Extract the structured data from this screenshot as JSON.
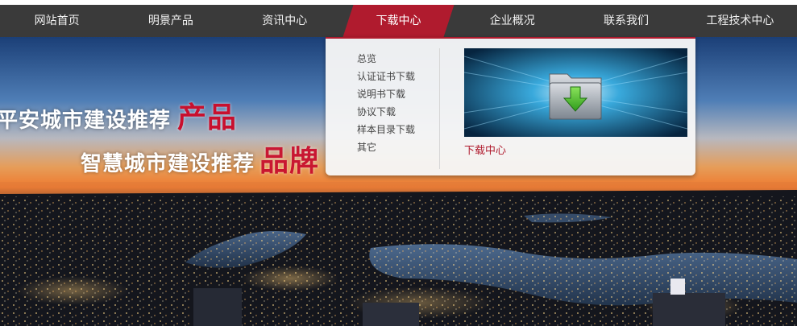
{
  "nav": {
    "items": [
      {
        "label": "网站首页",
        "active": false
      },
      {
        "label": "明景产品",
        "active": false
      },
      {
        "label": "资讯中心",
        "active": false
      },
      {
        "label": "下载中心",
        "active": true
      },
      {
        "label": "企业概况",
        "active": false
      },
      {
        "label": "联系我们",
        "active": false
      },
      {
        "label": "工程技术中心",
        "active": false
      }
    ]
  },
  "banner": {
    "line1_white": "平安城市建设推荐",
    "line1_red": "产品",
    "line2_white": "智慧城市建设推荐",
    "line2_red": "品牌"
  },
  "dropdown": {
    "items": [
      "总览",
      "认证证书下载",
      "说明书下载",
      "协议下载",
      "样本目录下载",
      "其它"
    ],
    "feature_caption": "下载中心",
    "feature_icon": "folder-download-icon"
  },
  "colors": {
    "accent": "#b01b2e",
    "nav_bg": "#3a3a3a"
  }
}
